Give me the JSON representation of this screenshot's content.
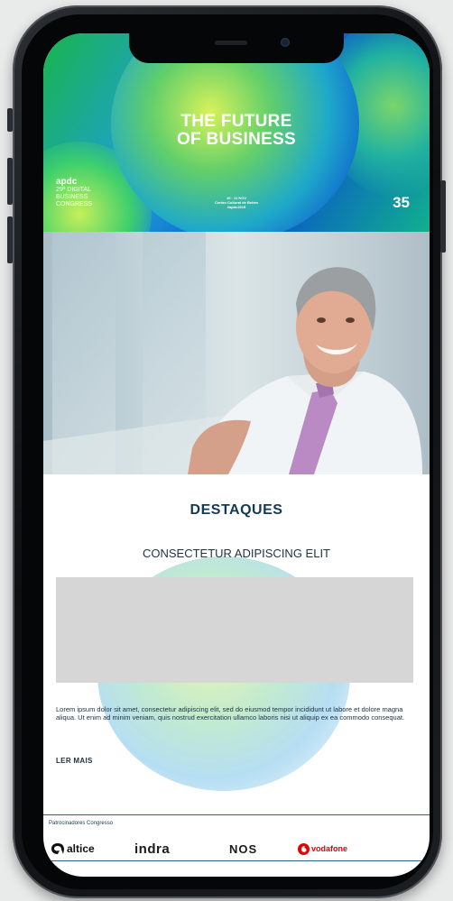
{
  "hero": {
    "title_line1": "THE FUTURE",
    "title_line2": "OF BUSINESS",
    "brand_logo": "apdc",
    "brand_line1": "29º DIGITAL",
    "brand_line2": "BUSINESS",
    "brand_line3": "CONGRESS",
    "event_date": "10 · 11 NOV",
    "event_place": "Centro Cultural de Belém",
    "event_hashtag": "#apdc2019",
    "anniversary": "35"
  },
  "content": {
    "section_title": "DESTAQUES",
    "subtitle": "CONSECTETUR ADIPISCING ELIT",
    "body": "Lorem ipsum dolor sit amet, consectetur adipiscing elit, sed do eiusmod tempor incididunt ut labore et dolore magna aliqua. Ut enim ad minim veniam, quis nostrud exercitation ullamco laboris nisi ut aliquip ex ea commodo consequat.",
    "more_link": "LER MAIS"
  },
  "sponsors": {
    "label": "Patrocinadores Congresso",
    "items": [
      {
        "name": "altice",
        "icon": "altice-icon"
      },
      {
        "name": "indra"
      },
      {
        "name": "NOS"
      },
      {
        "name": "vodafone",
        "icon": "vodafone-icon"
      }
    ]
  },
  "colors": {
    "title_navy": "#123a55",
    "vodafone_red": "#e60000",
    "placeholder_gray": "#d6d6d6"
  }
}
